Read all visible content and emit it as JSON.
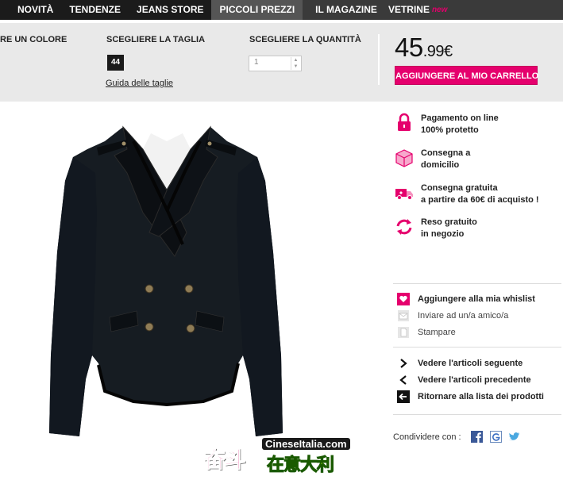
{
  "nav": {
    "items": [
      "NOVITÀ",
      "TENDENZE",
      "JEANS STORE",
      "PICCOLI PREZZI",
      "IL MAGAZINE",
      "VETRINE"
    ],
    "new_badge": "new"
  },
  "options": {
    "color_label": "RE UN COLORE",
    "size_label": "SCEGLIERE LA TAGLIA",
    "size_value": "44",
    "size_guide": "Guida delle taglie",
    "quantity_label": "SCEGLIERE LA QUANTITÀ",
    "quantity_value": "1"
  },
  "price": {
    "integer": "45",
    "decimal": ".99€"
  },
  "cart_button": "AGGIUNGERE AL MIO CARRELLO",
  "features": [
    {
      "icon": "lock-icon",
      "line1": "Pagamento on line",
      "line2": "100% protetto"
    },
    {
      "icon": "package-icon",
      "line1": "Consegna a",
      "line2": "domicilio"
    },
    {
      "icon": "delivery-truck-icon",
      "line1": "Consegna gratuita",
      "line2": "a partire da 60€ di acquisto !"
    },
    {
      "icon": "return-arrows-icon",
      "line1": "Reso gratuito",
      "line2": "in negozio"
    }
  ],
  "actions": {
    "wishlist": "Aggiungere alla mia whislist",
    "send_friend": "Inviare ad un/a amico/a",
    "print": "Stampare"
  },
  "navigation": {
    "next": "Vedere l'articoli seguente",
    "previous": "Vedere l'articoli precedente",
    "back_to_list": "Ritornare alla lista dei prodotti"
  },
  "share": {
    "label": "Condividere con :"
  },
  "watermark": {
    "site": "CineseItalia.com",
    "chinese_1": "奋斗",
    "chinese_2": "在意大利"
  },
  "colors": {
    "accent": "#e5006d",
    "nav_bg": "#1b1b1b",
    "options_bg": "#e9e9e9"
  }
}
